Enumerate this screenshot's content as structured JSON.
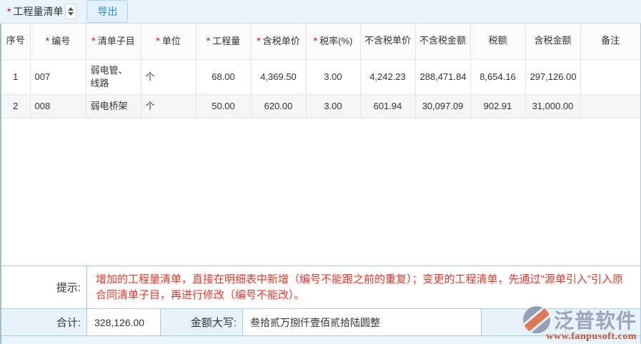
{
  "toolbar": {
    "required_mark": "*",
    "field_label": "工程量清单",
    "export_label": "导出"
  },
  "table": {
    "required_mark": "*",
    "columns": [
      {
        "label": "序号",
        "required": false
      },
      {
        "label": "编号",
        "required": true
      },
      {
        "label": "清单子目",
        "required": true
      },
      {
        "label": "单位",
        "required": true
      },
      {
        "label": "工程量",
        "required": true
      },
      {
        "label": "含税单价",
        "required": true
      },
      {
        "label": "税率(%)",
        "required": true
      },
      {
        "label": "不含税单价",
        "required": false
      },
      {
        "label": "不含税金额",
        "required": false
      },
      {
        "label": "税额",
        "required": false
      },
      {
        "label": "含税金额",
        "required": false
      },
      {
        "label": "备注",
        "required": false
      }
    ],
    "rows": [
      [
        "1",
        "007",
        "弱电管、线路",
        "个",
        "68.00",
        "4,369.50",
        "3.00",
        "4,242.23",
        "288,471.84",
        "8,654.16",
        "297,126.00",
        ""
      ],
      [
        "2",
        "008",
        "弱电桥架",
        "个",
        "50.00",
        "620.00",
        "3.00",
        "601.94",
        "30,097.09",
        "902.91",
        "31,000.00",
        ""
      ]
    ]
  },
  "footer": {
    "hint_label": "提示:",
    "hint_text": "增加的工程量清单，直接在明细表中新增（编号不能跟之前的重复）；变更的工程清单，先通过\"源单引入\"引入原合同清单子目，再进行修改（编号不能改）。",
    "total_label": "合计:",
    "total_value": "328,126.00",
    "amount_words_label": "金额大写:",
    "amount_words_value": "叁拾贰万捌仟壹佰贰拾陆圆整"
  },
  "watermark": {
    "brand": "泛普软件",
    "url": "www.fanpusoft.com"
  },
  "colors": {
    "toolbar_bg": "#e9f3fc",
    "export_blue": "#2a8cd8",
    "required_red": "#e60000",
    "hint_red": "#e6392b",
    "footer_bg_blue": "#e8f2fb",
    "border_blue": "#a9cbe1",
    "outer_edge_blue": "#9cbfd5",
    "grid_border_gray": "#e4e4e4",
    "row_alt_bg": "#f6f6f7",
    "brand_gray_blue": "#96a2b8",
    "brand_orange": "#dd7350",
    "url_red": "#c6492e"
  }
}
